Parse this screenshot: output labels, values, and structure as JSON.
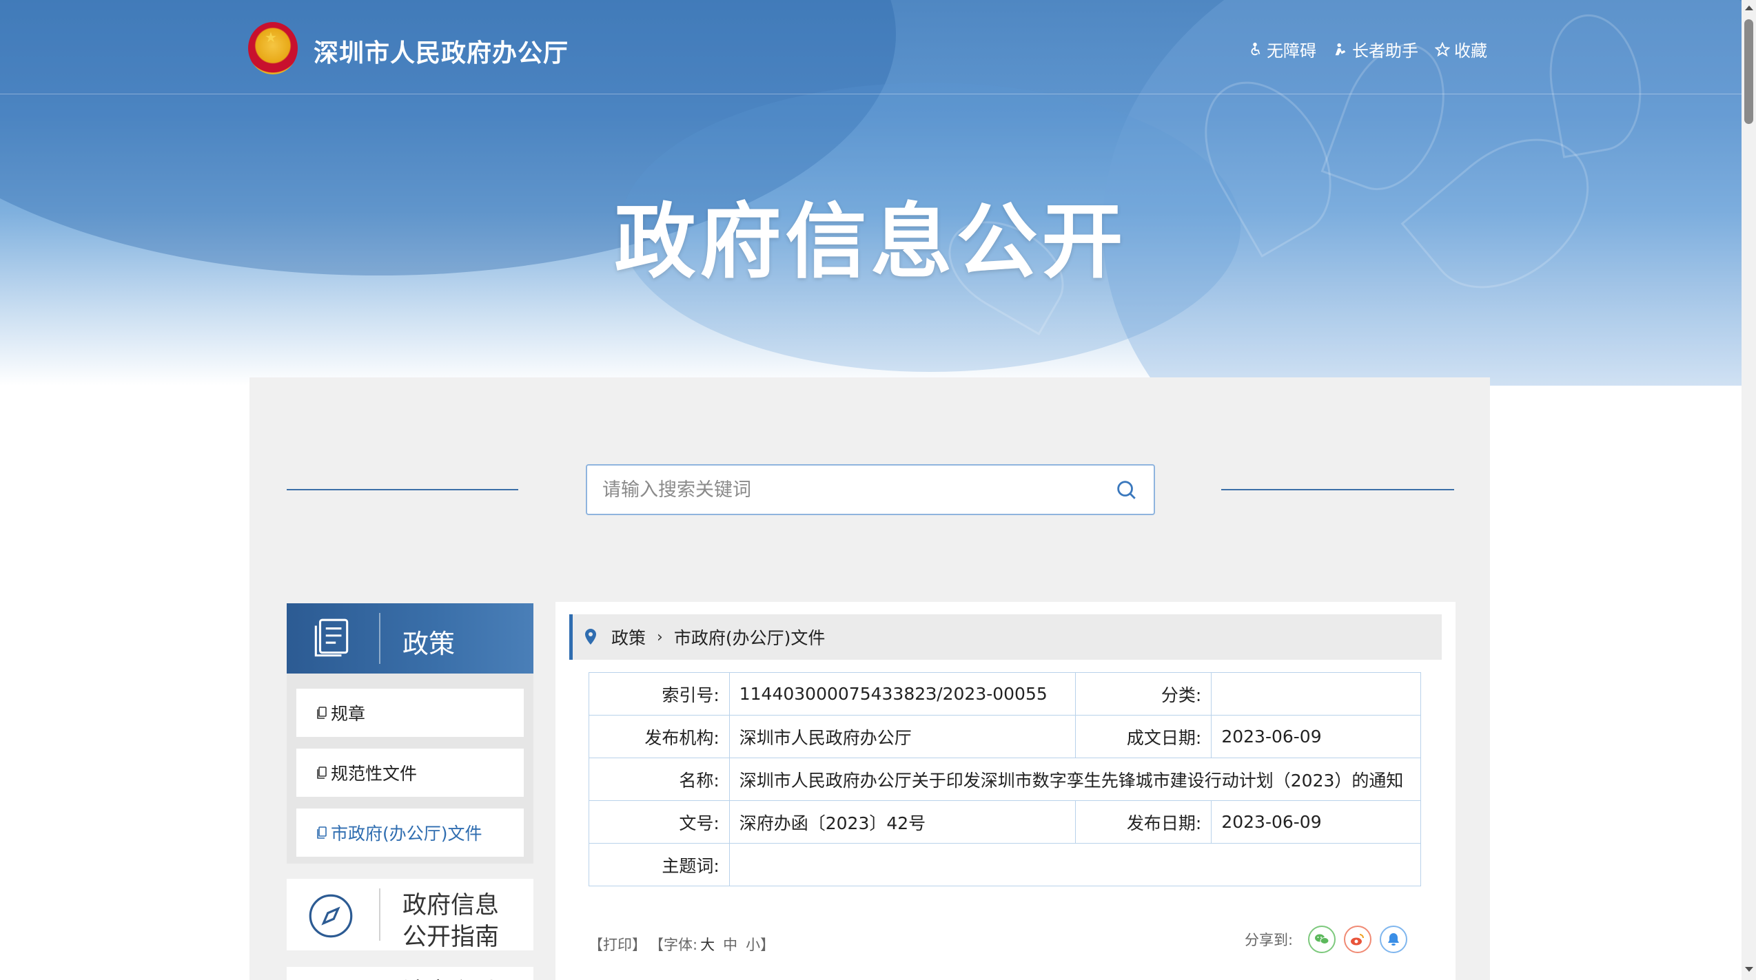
{
  "header": {
    "site_title": "深圳市人民政府办公厅",
    "links": [
      {
        "label": "无障碍",
        "icon": "accessibility-icon"
      },
      {
        "label": "长者助手",
        "icon": "elder-assistant-icon"
      },
      {
        "label": "收藏",
        "icon": "star-icon"
      }
    ]
  },
  "banner": {
    "title": "政府信息公开"
  },
  "search": {
    "placeholder": "请输入搜索关键词"
  },
  "sidebar": {
    "section_title": "政策",
    "items": [
      {
        "label": "规章",
        "active": false
      },
      {
        "label": "规范性文件",
        "active": false
      },
      {
        "label": "市政府(办公厅)文件",
        "active": true
      }
    ],
    "guide_line1": "政府信息",
    "guide_line2": "公开指南",
    "next_partial": "法定主动"
  },
  "breadcrumb": {
    "items": [
      "政策",
      "市政府(办公厅)文件"
    ]
  },
  "info": {
    "index_label": "索引号:",
    "index_value": "11440300007543382З/2023-00055",
    "category_label": "分类:",
    "category_value": "",
    "org_label": "发布机构:",
    "org_value": "深圳市人民政府办公厅",
    "created_label": "成文日期:",
    "created_value": "2023-06-09",
    "name_label": "名称:",
    "name_value": "深圳市人民政府办公厅关于印发深圳市数字孪生先锋城市建设行动计划（2023）的通知",
    "docno_label": "文号:",
    "docno_value": "深府办函〔2023〕42号",
    "pubdate_label": "发布日期:",
    "pubdate_value": "2023-06-09",
    "subject_label": "主题词:",
    "subject_value": ""
  },
  "tools": {
    "print": "【打印】",
    "font_prefix": "【字体:",
    "font_large": "大",
    "font_medium": "中",
    "font_small": "小】",
    "share_label": "分享到:"
  },
  "colors": {
    "accent": "#2f6db0",
    "wechat": "#5cb85c",
    "weibo": "#e8543a",
    "qq": "#3a8ee6"
  }
}
